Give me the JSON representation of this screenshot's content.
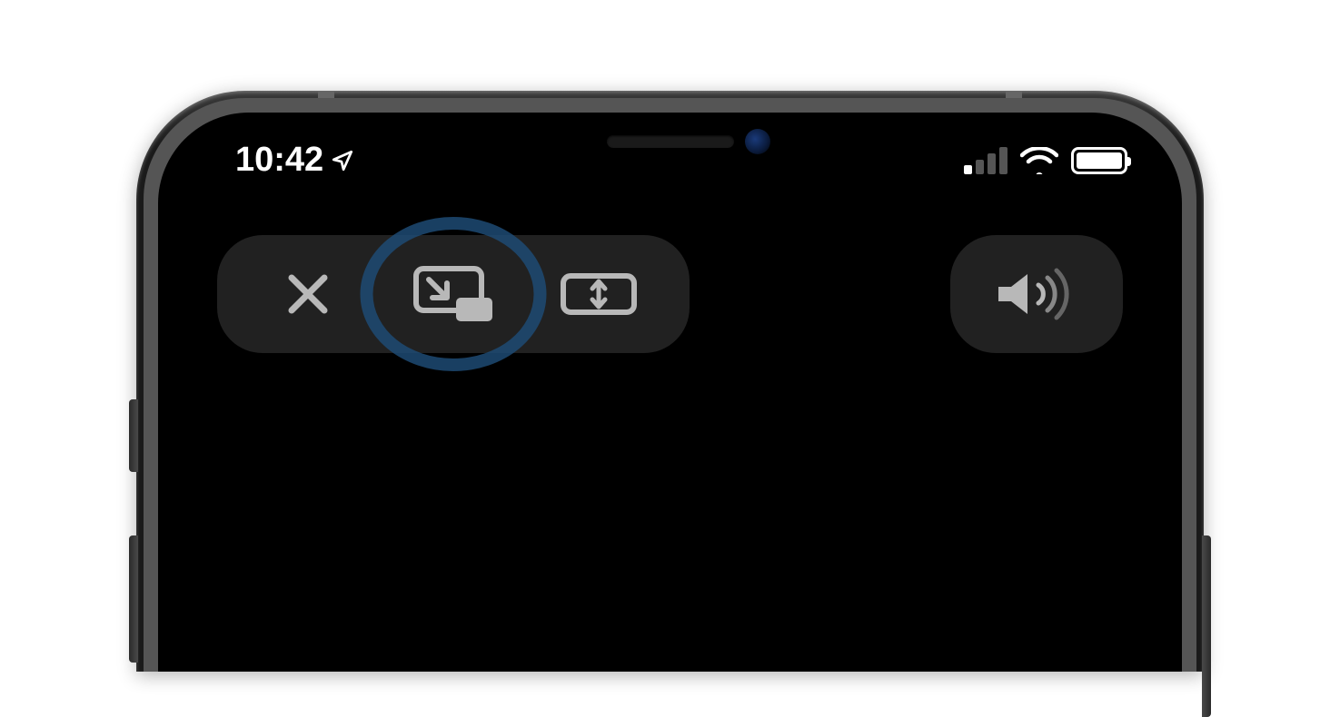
{
  "status_bar": {
    "time": "10:42",
    "location_active": true,
    "cellular_bars": 1,
    "wifi_active": true,
    "battery_level": 100
  },
  "controls": {
    "close_label": "close",
    "pip_label": "picture-in-picture",
    "aspect_label": "rotate-fit",
    "volume_label": "volume",
    "highlighted": "pip"
  },
  "colors": {
    "highlight": "#1d4a73",
    "icon": "#b8b8b8",
    "pill_bg": "rgba(60,60,60,0.55)"
  }
}
